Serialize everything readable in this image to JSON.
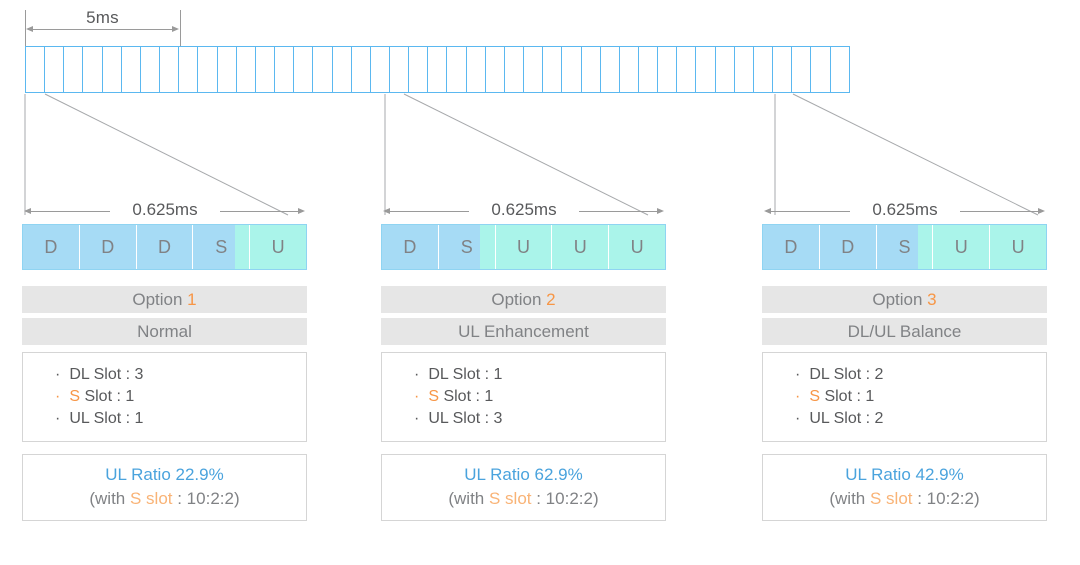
{
  "frame": {
    "span_label": "5ms",
    "subframe_count": 43,
    "border_color": "#5bb8f0"
  },
  "slot_duration_label": "0.625ms",
  "colors": {
    "dl_slot": "#a6dbf5",
    "ul_slot": "#aaf4ea",
    "accent": "#f79646",
    "ratio_blue": "#4aa3dd",
    "header_bg": "#e6e6e6",
    "text_gray": "#58595b"
  },
  "options": [
    {
      "title_prefix": "Option",
      "title_number": "1",
      "subtitle": "Normal",
      "slots": [
        {
          "type": "dl",
          "label": "D"
        },
        {
          "type": "dl",
          "label": "D"
        },
        {
          "type": "dl",
          "label": "D"
        },
        {
          "type": "s",
          "label": "S"
        },
        {
          "type": "ul",
          "label": "U"
        }
      ],
      "info": [
        {
          "bullet_accent": false,
          "text": "DL Slot : 3",
          "accent_prefix": ""
        },
        {
          "bullet_accent": true,
          "text": " Slot : 1",
          "accent_prefix": "S"
        },
        {
          "bullet_accent": false,
          "text": "UL Slot : 1",
          "accent_prefix": ""
        }
      ],
      "ratio_main": "UL Ratio 22.9%",
      "ratio_sub_pre": "(with ",
      "ratio_sub_accent": "S slot",
      "ratio_sub_post": " : 10:2:2)",
      "duration_label": "0.625ms"
    },
    {
      "title_prefix": "Option",
      "title_number": "2",
      "subtitle": "UL Enhancement",
      "slots": [
        {
          "type": "dl",
          "label": "D"
        },
        {
          "type": "s",
          "label": "S"
        },
        {
          "type": "ul",
          "label": "U"
        },
        {
          "type": "ul",
          "label": "U"
        },
        {
          "type": "ul",
          "label": "U"
        }
      ],
      "info": [
        {
          "bullet_accent": false,
          "text": "DL Slot : 1",
          "accent_prefix": ""
        },
        {
          "bullet_accent": true,
          "text": " Slot : 1",
          "accent_prefix": "S"
        },
        {
          "bullet_accent": false,
          "text": "UL Slot : 3",
          "accent_prefix": ""
        }
      ],
      "ratio_main": "UL Ratio 62.9%",
      "ratio_sub_pre": "(with ",
      "ratio_sub_accent": "S slot",
      "ratio_sub_post": " : 10:2:2)",
      "duration_label": "0.625ms"
    },
    {
      "title_prefix": "Option",
      "title_number": "3",
      "subtitle": "DL/UL Balance",
      "slots": [
        {
          "type": "dl",
          "label": "D"
        },
        {
          "type": "dl",
          "label": "D"
        },
        {
          "type": "s",
          "label": "S"
        },
        {
          "type": "ul",
          "label": "U"
        },
        {
          "type": "ul",
          "label": "U"
        }
      ],
      "info": [
        {
          "bullet_accent": false,
          "text": "DL Slot : 2",
          "accent_prefix": ""
        },
        {
          "bullet_accent": true,
          "text": " Slot : 1",
          "accent_prefix": "S"
        },
        {
          "bullet_accent": false,
          "text": "UL Slot : 2",
          "accent_prefix": ""
        }
      ],
      "ratio_main": "UL Ratio 42.9%",
      "ratio_sub_pre": "(with ",
      "ratio_sub_accent": "S slot",
      "ratio_sub_post": " : 10:2:2)",
      "duration_label": "0.625ms"
    }
  ]
}
